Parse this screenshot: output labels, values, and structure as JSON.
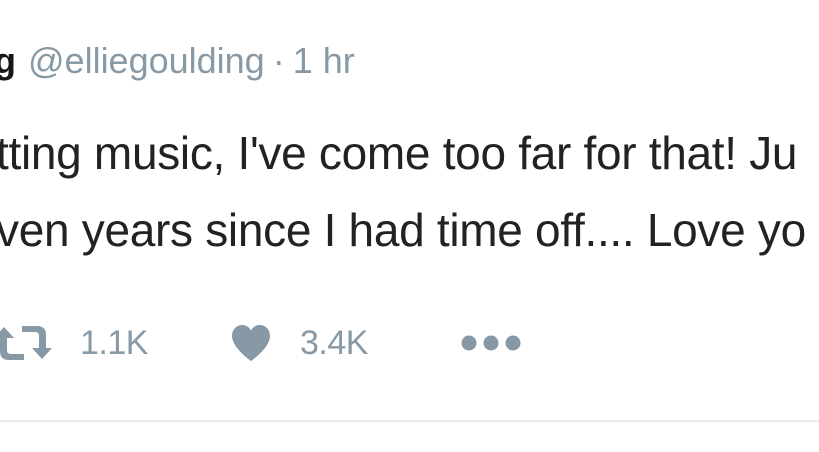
{
  "tweet": {
    "display_name_fragment": "g",
    "handle": "@elliegoulding",
    "separator": "·",
    "timestamp": "1 hr",
    "text_lines": [
      "tting music, I've come too far for that! Ju",
      "ven years since I had time off.... Love yo"
    ],
    "actions": {
      "retweet_count": "1.1K",
      "like_count": "3.4K",
      "retweet_icon": "retweet-icon",
      "like_icon": "heart-icon",
      "more_icon": "more-dots-icon"
    },
    "colors": {
      "text": "#14171a",
      "muted": "#8899a6",
      "divider": "#e6ecf0"
    }
  }
}
